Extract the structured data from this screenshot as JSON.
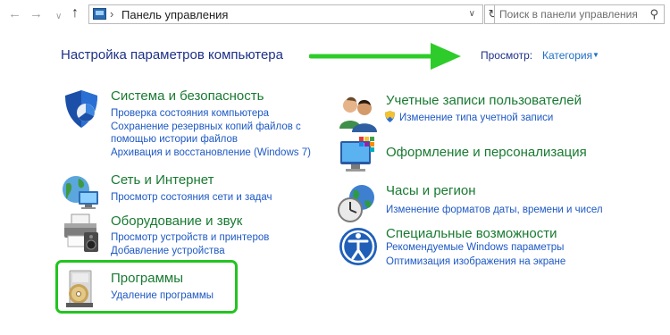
{
  "address_bar": {
    "back_icon": "arrow-left-icon",
    "forward_icon": "arrow-right-icon",
    "up_icon": "arrow-up-icon",
    "breadcrumb": "Панель управления",
    "search_placeholder": "Поиск в панели управления"
  },
  "header": {
    "title": "Настройка параметров компьютера",
    "view_label": "Просмотр:",
    "view_value": "Категория"
  },
  "categories": [
    {
      "title": "Система и безопасность",
      "icon": "shield-icon",
      "links": [
        "Проверка состояния компьютера",
        "Сохранение резервных копий файлов с",
        "помощью истории файлов",
        "Архивация и восстановление (Windows 7)"
      ]
    },
    {
      "title": "Сеть и Интернет",
      "icon": "network-globe-icon",
      "links": [
        "Просмотр состояния сети и задач"
      ]
    },
    {
      "title": "Оборудование и звук",
      "icon": "printer-icon",
      "links": [
        "Просмотр устройств и принтеров",
        "Добавление устройства"
      ]
    },
    {
      "title": "Программы",
      "icon": "programs-disc-icon",
      "links": [
        "Удаление программы"
      ]
    },
    {
      "title": "Учетные записи пользователей",
      "icon": "users-icon",
      "links": [
        "Изменение типа учетной записи"
      ]
    },
    {
      "title": "Оформление и персонализация",
      "icon": "monitor-palette-icon",
      "links": []
    },
    {
      "title": "Часы и регион",
      "icon": "clock-globe-icon",
      "links": [
        "Изменение форматов даты, времени и чисел"
      ]
    },
    {
      "title": "Специальные возможности",
      "icon": "accessibility-icon",
      "links": [
        "Рекомендуемые Windows параметры",
        "Оптимизация изображения на экране"
      ]
    }
  ],
  "colors": {
    "heading_green": "#187a31",
    "link_blue": "#1e59c4",
    "title_navy": "#1e3287",
    "annotation_green": "#22c41f"
  }
}
